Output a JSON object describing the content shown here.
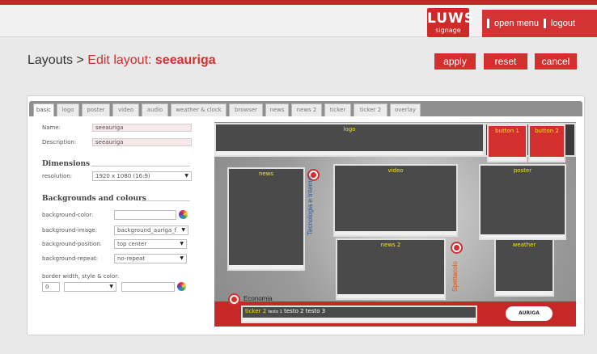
{
  "header": {
    "brand_main": "LUWS",
    "brand_sub": "signage",
    "menu_open": "open menu",
    "menu_logout": "logout"
  },
  "page": {
    "crumb_root": "Layouts",
    "crumb_sep": ">",
    "crumb_edit": "Edit layout:",
    "layout_name": "seeauriga"
  },
  "actions": {
    "apply": "apply",
    "reset": "reset",
    "cancel": "cancel"
  },
  "tabs": [
    "basic",
    "logo",
    "poster",
    "video",
    "audio",
    "weather & clock",
    "browser",
    "news",
    "news 2",
    "ticker",
    "ticker 2",
    "overlay"
  ],
  "form": {
    "name_label": "Name:",
    "name_value": "seeauriga",
    "desc_label": "Description:",
    "desc_value": "seeauriga",
    "dimensions_title": "Dimensions",
    "resolution_label": "resolution:",
    "resolution_value": "1920 x 1080 (16:9)",
    "bg_title": "Backgrounds and colours",
    "bg_color_label": "background-color:",
    "bg_color_value": "",
    "bg_image_label": "background-image:",
    "bg_image_value": "background_auriga_f",
    "bg_position_label": "background-position:",
    "bg_position_value": "top center",
    "bg_repeat_label": "background-repeat:",
    "bg_repeat_value": "no-repeat",
    "border_label": "border width, style & color:",
    "border_width": "0",
    "border_style": "",
    "border_color": ""
  },
  "preview": {
    "logo": "logo",
    "button1": "button 1",
    "button2": "button 2",
    "news": "news",
    "video": "video",
    "poster": "poster",
    "news2": "news 2",
    "weather": "weather",
    "tech_label": "Tecnologia e Internet",
    "spettacolo_label": "Spettacolo",
    "economia_label": "Economia",
    "ticker_text1": "ticker 2",
    "ticker_text2": "testo 1",
    "ticker_text3": "testo 2",
    "ticker_text4": "testo 3",
    "auriga_logo": "AURIGA"
  },
  "colors": {
    "accent": "#d32f2f",
    "zone": "#4a4a4a",
    "zone_label": "#f2e22a"
  }
}
